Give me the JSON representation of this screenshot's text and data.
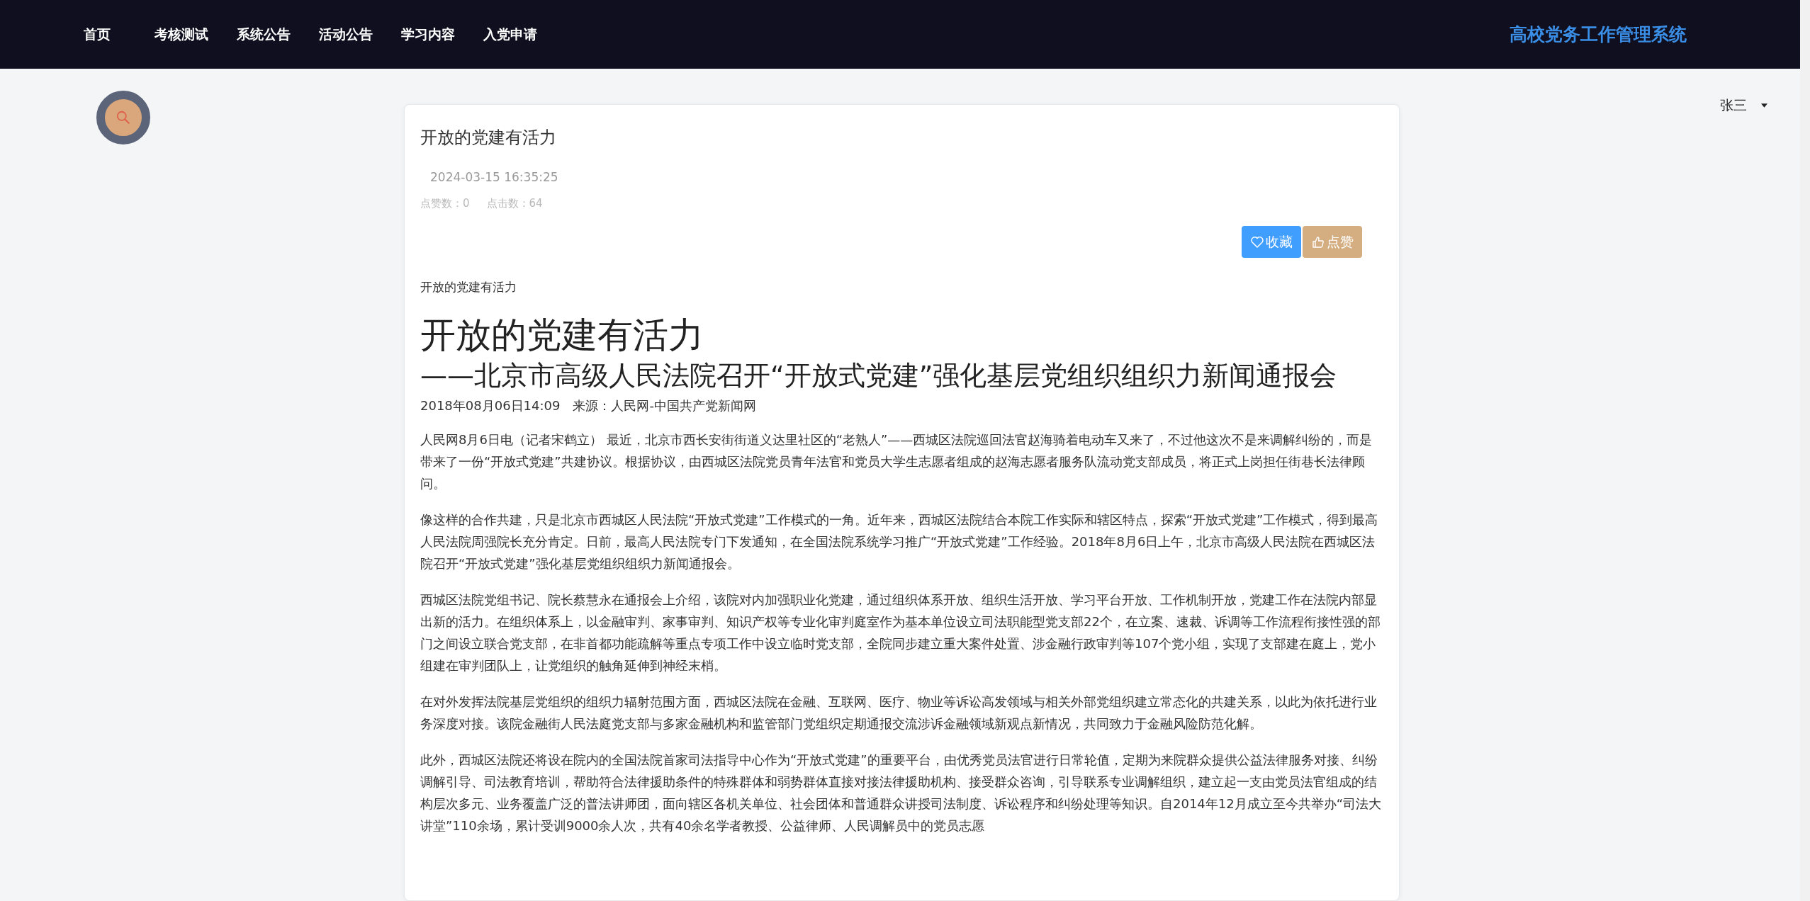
{
  "nav": {
    "items": [
      "首页",
      "考核测试",
      "系统公告",
      "活动公告",
      "学习内容",
      "入党申请"
    ],
    "site_title": "高校党务工作管理系统"
  },
  "user": {
    "name": "张三"
  },
  "article": {
    "title": "开放的党建有活力",
    "date": "2024-03-15 16:35:25",
    "stats": [
      "点赞数：0",
      "点击数：64"
    ],
    "buttons": [
      {
        "label": "收藏",
        "kind": "favorite"
      },
      {
        "label": "点赞",
        "kind": "like"
      }
    ],
    "summary": "开放的党建有活力",
    "heading": "开放的党建有活力",
    "subheading": "——北京市高级人民法院召开“开放式党建”强化基层党组织组织力新闻通报会",
    "meta": "2018年08月06日14:09　来源：人民网-中国共产党新闻网",
    "paragraphs": [
      "人民网8月6日电（记者宋鹤立） 最近，北京市西长安街街道义达里社区的“老熟人”——西城区法院巡回法官赵海骑着电动车又来了，不过他这次不是来调解纠纷的，而是带来了一份“开放式党建”共建协议。根据协议，由西城区法院党员青年法官和党员大学生志愿者组成的赵海志愿者服务队流动党支部成员，将正式上岗担任街巷长法律顾问。",
      "像这样的合作共建，只是北京市西城区人民法院“开放式党建”工作模式的一角。近年来，西城区法院结合本院工作实际和辖区特点，探索“开放式党建”工作模式，得到最高人民法院周强院长充分肯定。日前，最高人民法院专门下发通知，在全国法院系统学习推广“开放式党建”工作经验。2018年8月6日上午，北京市高级人民法院在西城区法院召开“开放式党建”强化基层党组织组织力新闻通报会。",
      "西城区法院党组书记、院长蔡慧永在通报会上介绍，该院对内加强职业化党建，通过组织体系开放、组织生活开放、学习平台开放、工作机制开放，党建工作在法院内部显出新的活力。在组织体系上，以金融审判、家事审判、知识产权等专业化审判庭室作为基本单位设立司法职能型党支部22个，在立案、速裁、诉调等工作流程衔接性强的部门之间设立联合党支部，在非首都功能疏解等重点专项工作中设立临时党支部，全院同步建立重大案件处置、涉金融行政审判等107个党小组，实现了支部建在庭上，党小组建在审判团队上，让党组织的触角延伸到神经末梢。",
      "在对外发挥法院基层党组织的组织力辐射范围方面，西城区法院在金融、互联网、医疗、物业等诉讼高发领域与相关外部党组织建立常态化的共建关系，以此为依托进行业务深度对接。该院金融街人民法庭党支部与多家金融机构和监管部门党组织定期通报交流涉诉金融领域新观点新情况，共同致力于金融风险防范化解。",
      "此外，西城区法院还将设在院内的全国法院首家司法指导中心作为“开放式党建”的重要平台，由优秀党员法官进行日常轮值，定期为来院群众提供公益法律服务对接、纠纷调解引导、司法教育培训，帮助符合法律援助条件的特殊群体和弱势群体直接对接法律援助机构、接受群众咨询，引导联系专业调解组织，建立起一支由党员法官组成的结构层次多元、业务覆盖广泛的普法讲师团，面向辖区各机关单位、社会团体和普通群众讲授司法制度、诉讼程序和纠纷处理等知识。自2014年12月成立至今共举办“司法大讲堂”110余场，累计受训9000余人次，共有40余名学者教授、公益律师、人民调解员中的党员志愿"
    ]
  }
}
